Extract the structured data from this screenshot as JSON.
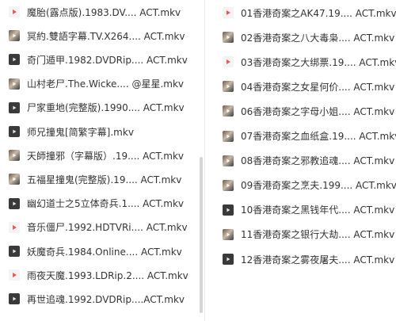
{
  "left_files": [
    {
      "name": "魔胎(露点版).1983.DV.... ACT.mkv",
      "thumb": "video"
    },
    {
      "name": "冥約.雙語字幕.TV.X264.... ACT.mkv",
      "thumb": "photo"
    },
    {
      "name": "奇门遁甲.1982.DVDRip.... ACT.mkv",
      "thumb": "dark"
    },
    {
      "name": "山村老尸.The.Wicke.... @星星.mkv",
      "thumb": "photo"
    },
    {
      "name": "尸家重地(完整版).1990.... ACT.mkv",
      "thumb": "dark"
    },
    {
      "name": "师兄撞鬼[简繁字幕].mkv",
      "thumb": "dark"
    },
    {
      "name": "天師撞邪（字幕版）.19.... ACT.mkv",
      "thumb": "photo"
    },
    {
      "name": "五福星撞鬼(完整版).19.... ACT.mkv",
      "thumb": "photo"
    },
    {
      "name": "幽幻道士之5立体奇兵.1.... ACT.mkv",
      "thumb": "dark"
    },
    {
      "name": "音乐僵尸.1992.HDTVRi.... ACT.mkv",
      "thumb": "video"
    },
    {
      "name": "妖魔奇兵.1984.Online.... ACT.mkv",
      "thumb": "dark"
    },
    {
      "name": "雨夜天魔.1993.LDRip.2.... ACT.mkv",
      "thumb": "video"
    },
    {
      "name": "再世追魂.1992.DVDRip....ACT.mkv",
      "thumb": "dark"
    }
  ],
  "right_files": [
    {
      "name": "01香港奇案之AK47.19.... ACT.mkv",
      "thumb": "video"
    },
    {
      "name": "02香港奇案之八大毒枭.... ACT.mkv",
      "thumb": "photo"
    },
    {
      "name": "03香港奇案之大绑票.19.... ACT.mkv",
      "thumb": "video"
    },
    {
      "name": "04香港奇案之女星何价.... ACT.mkv",
      "thumb": "photo"
    },
    {
      "name": "06香港奇案之字母小姐.... ACT.mkv",
      "thumb": "photo"
    },
    {
      "name": "07香港奇案之血纸盒.19.... ACT.mkv",
      "thumb": "photo"
    },
    {
      "name": "08香港奇案之邪教追魂.... ACT.mkv",
      "thumb": "photo"
    },
    {
      "name": "09香港奇案之烹夫.199.... ACT.mkv",
      "thumb": "photo"
    },
    {
      "name": "10香港奇案之黑钱年代.... ACT.mkv",
      "thumb": "dark"
    },
    {
      "name": "11香港奇案之银行大劫.... ACT.mkv",
      "thumb": "photo"
    },
    {
      "name": "12香港奇案之雾夜屠夫.... ACT.mkv",
      "thumb": "dark"
    }
  ],
  "colors": {
    "text": "#333333",
    "video_icon_bg": "#f4f4f4",
    "video_icon_play": "#e8595a",
    "dark_thumb": "#3a3a3a",
    "scrollbar": "#d6d6d6"
  },
  "icons": {
    "video": "video-file-icon",
    "photo": "video-thumbnail-icon",
    "dark": "video-thumbnail-icon"
  }
}
